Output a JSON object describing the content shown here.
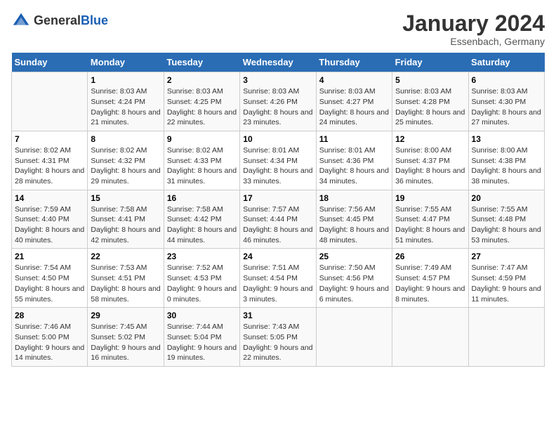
{
  "logo": {
    "general": "General",
    "blue": "Blue"
  },
  "title": "January 2024",
  "location": "Essenbach, Germany",
  "days_header": [
    "Sunday",
    "Monday",
    "Tuesday",
    "Wednesday",
    "Thursday",
    "Friday",
    "Saturday"
  ],
  "weeks": [
    [
      {
        "num": "",
        "sunrise": "",
        "sunset": "",
        "daylight": ""
      },
      {
        "num": "1",
        "sunrise": "Sunrise: 8:03 AM",
        "sunset": "Sunset: 4:24 PM",
        "daylight": "Daylight: 8 hours and 21 minutes."
      },
      {
        "num": "2",
        "sunrise": "Sunrise: 8:03 AM",
        "sunset": "Sunset: 4:25 PM",
        "daylight": "Daylight: 8 hours and 22 minutes."
      },
      {
        "num": "3",
        "sunrise": "Sunrise: 8:03 AM",
        "sunset": "Sunset: 4:26 PM",
        "daylight": "Daylight: 8 hours and 23 minutes."
      },
      {
        "num": "4",
        "sunrise": "Sunrise: 8:03 AM",
        "sunset": "Sunset: 4:27 PM",
        "daylight": "Daylight: 8 hours and 24 minutes."
      },
      {
        "num": "5",
        "sunrise": "Sunrise: 8:03 AM",
        "sunset": "Sunset: 4:28 PM",
        "daylight": "Daylight: 8 hours and 25 minutes."
      },
      {
        "num": "6",
        "sunrise": "Sunrise: 8:03 AM",
        "sunset": "Sunset: 4:30 PM",
        "daylight": "Daylight: 8 hours and 27 minutes."
      }
    ],
    [
      {
        "num": "7",
        "sunrise": "Sunrise: 8:02 AM",
        "sunset": "Sunset: 4:31 PM",
        "daylight": "Daylight: 8 hours and 28 minutes."
      },
      {
        "num": "8",
        "sunrise": "Sunrise: 8:02 AM",
        "sunset": "Sunset: 4:32 PM",
        "daylight": "Daylight: 8 hours and 29 minutes."
      },
      {
        "num": "9",
        "sunrise": "Sunrise: 8:02 AM",
        "sunset": "Sunset: 4:33 PM",
        "daylight": "Daylight: 8 hours and 31 minutes."
      },
      {
        "num": "10",
        "sunrise": "Sunrise: 8:01 AM",
        "sunset": "Sunset: 4:34 PM",
        "daylight": "Daylight: 8 hours and 33 minutes."
      },
      {
        "num": "11",
        "sunrise": "Sunrise: 8:01 AM",
        "sunset": "Sunset: 4:36 PM",
        "daylight": "Daylight: 8 hours and 34 minutes."
      },
      {
        "num": "12",
        "sunrise": "Sunrise: 8:00 AM",
        "sunset": "Sunset: 4:37 PM",
        "daylight": "Daylight: 8 hours and 36 minutes."
      },
      {
        "num": "13",
        "sunrise": "Sunrise: 8:00 AM",
        "sunset": "Sunset: 4:38 PM",
        "daylight": "Daylight: 8 hours and 38 minutes."
      }
    ],
    [
      {
        "num": "14",
        "sunrise": "Sunrise: 7:59 AM",
        "sunset": "Sunset: 4:40 PM",
        "daylight": "Daylight: 8 hours and 40 minutes."
      },
      {
        "num": "15",
        "sunrise": "Sunrise: 7:58 AM",
        "sunset": "Sunset: 4:41 PM",
        "daylight": "Daylight: 8 hours and 42 minutes."
      },
      {
        "num": "16",
        "sunrise": "Sunrise: 7:58 AM",
        "sunset": "Sunset: 4:42 PM",
        "daylight": "Daylight: 8 hours and 44 minutes."
      },
      {
        "num": "17",
        "sunrise": "Sunrise: 7:57 AM",
        "sunset": "Sunset: 4:44 PM",
        "daylight": "Daylight: 8 hours and 46 minutes."
      },
      {
        "num": "18",
        "sunrise": "Sunrise: 7:56 AM",
        "sunset": "Sunset: 4:45 PM",
        "daylight": "Daylight: 8 hours and 48 minutes."
      },
      {
        "num": "19",
        "sunrise": "Sunrise: 7:55 AM",
        "sunset": "Sunset: 4:47 PM",
        "daylight": "Daylight: 8 hours and 51 minutes."
      },
      {
        "num": "20",
        "sunrise": "Sunrise: 7:55 AM",
        "sunset": "Sunset: 4:48 PM",
        "daylight": "Daylight: 8 hours and 53 minutes."
      }
    ],
    [
      {
        "num": "21",
        "sunrise": "Sunrise: 7:54 AM",
        "sunset": "Sunset: 4:50 PM",
        "daylight": "Daylight: 8 hours and 55 minutes."
      },
      {
        "num": "22",
        "sunrise": "Sunrise: 7:53 AM",
        "sunset": "Sunset: 4:51 PM",
        "daylight": "Daylight: 8 hours and 58 minutes."
      },
      {
        "num": "23",
        "sunrise": "Sunrise: 7:52 AM",
        "sunset": "Sunset: 4:53 PM",
        "daylight": "Daylight: 9 hours and 0 minutes."
      },
      {
        "num": "24",
        "sunrise": "Sunrise: 7:51 AM",
        "sunset": "Sunset: 4:54 PM",
        "daylight": "Daylight: 9 hours and 3 minutes."
      },
      {
        "num": "25",
        "sunrise": "Sunrise: 7:50 AM",
        "sunset": "Sunset: 4:56 PM",
        "daylight": "Daylight: 9 hours and 6 minutes."
      },
      {
        "num": "26",
        "sunrise": "Sunrise: 7:49 AM",
        "sunset": "Sunset: 4:57 PM",
        "daylight": "Daylight: 9 hours and 8 minutes."
      },
      {
        "num": "27",
        "sunrise": "Sunrise: 7:47 AM",
        "sunset": "Sunset: 4:59 PM",
        "daylight": "Daylight: 9 hours and 11 minutes."
      }
    ],
    [
      {
        "num": "28",
        "sunrise": "Sunrise: 7:46 AM",
        "sunset": "Sunset: 5:00 PM",
        "daylight": "Daylight: 9 hours and 14 minutes."
      },
      {
        "num": "29",
        "sunrise": "Sunrise: 7:45 AM",
        "sunset": "Sunset: 5:02 PM",
        "daylight": "Daylight: 9 hours and 16 minutes."
      },
      {
        "num": "30",
        "sunrise": "Sunrise: 7:44 AM",
        "sunset": "Sunset: 5:04 PM",
        "daylight": "Daylight: 9 hours and 19 minutes."
      },
      {
        "num": "31",
        "sunrise": "Sunrise: 7:43 AM",
        "sunset": "Sunset: 5:05 PM",
        "daylight": "Daylight: 9 hours and 22 minutes."
      },
      {
        "num": "",
        "sunrise": "",
        "sunset": "",
        "daylight": ""
      },
      {
        "num": "",
        "sunrise": "",
        "sunset": "",
        "daylight": ""
      },
      {
        "num": "",
        "sunrise": "",
        "sunset": "",
        "daylight": ""
      }
    ]
  ]
}
